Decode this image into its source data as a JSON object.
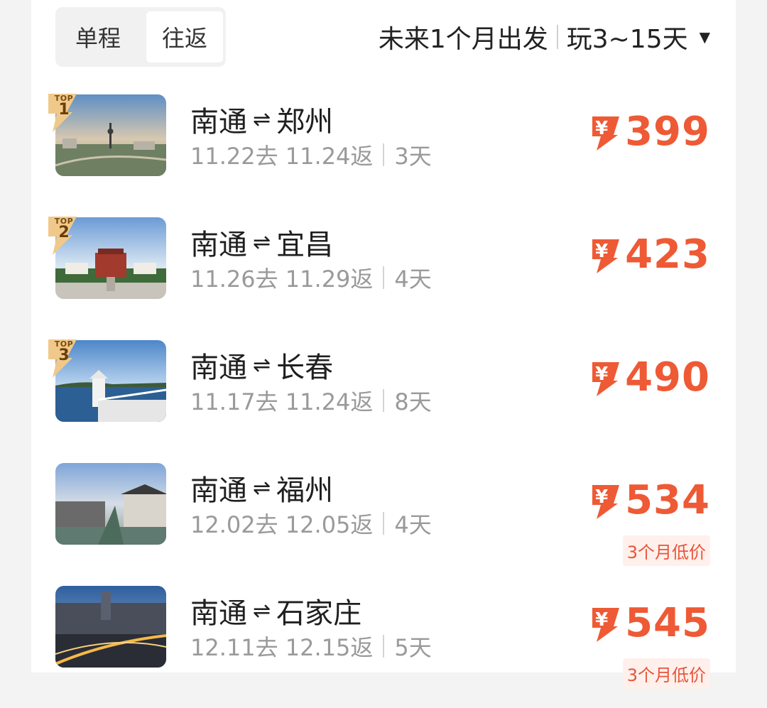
{
  "header": {
    "tab_oneway": "单程",
    "tab_roundtrip": "往返",
    "filter_period": "未来1个月出发",
    "filter_duration": "玩3~15天",
    "caret_icon": "caret-down-icon"
  },
  "currency_symbol": "¥",
  "route_arrow": "⇌",
  "rows": [
    {
      "top_label": "TOP",
      "rank": "1",
      "from": "南通",
      "to": "郑州",
      "depart": "11.22去",
      "return": "11.24返",
      "days": "3天",
      "price": "399",
      "low_tag": ""
    },
    {
      "top_label": "TOP",
      "rank": "2",
      "from": "南通",
      "to": "宜昌",
      "depart": "11.26去",
      "return": "11.29返",
      "days": "4天",
      "price": "423",
      "low_tag": ""
    },
    {
      "top_label": "TOP",
      "rank": "3",
      "from": "南通",
      "to": "长春",
      "depart": "11.17去",
      "return": "11.24返",
      "days": "8天",
      "price": "490",
      "low_tag": ""
    },
    {
      "top_label": "",
      "rank": "",
      "from": "南通",
      "to": "福州",
      "depart": "12.02去",
      "return": "12.05返",
      "days": "4天",
      "price": "534",
      "low_tag": "3个月低价"
    },
    {
      "top_label": "",
      "rank": "",
      "from": "南通",
      "to": "石家庄",
      "depart": "12.11去",
      "return": "12.15返",
      "days": "5天",
      "price": "545",
      "low_tag": "3个月低价"
    }
  ],
  "colors": {
    "price": "#ee5a35",
    "badge_gold": "#f0c98a",
    "muted_text": "#9a9a9a"
  }
}
